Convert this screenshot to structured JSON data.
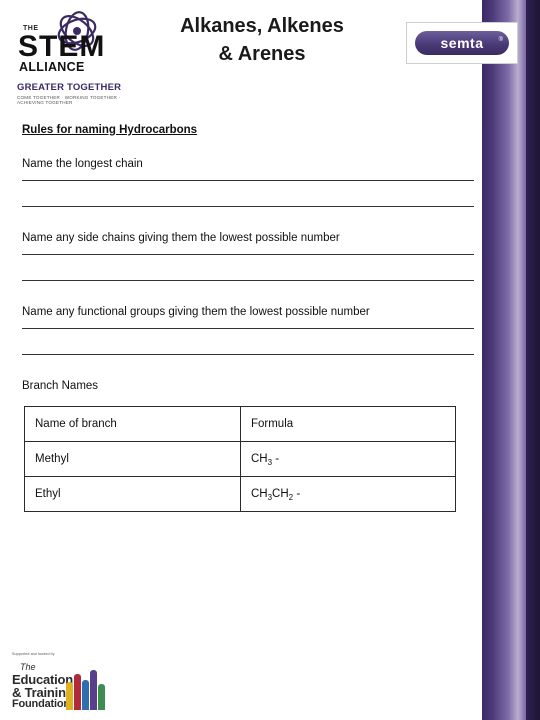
{
  "slide": {
    "title_line1": "Alkanes, Alkenes",
    "title_line2": "& Arenes"
  },
  "logos": {
    "stem": {
      "the": "THE",
      "name": "STEM",
      "sub": "ALLIANCE",
      "strapline": "GREATER TOGETHER",
      "tagline": "COME TOGETHER · WORKING TOGETHER · ACHIEVING TOGETHER"
    },
    "semta": {
      "name": "semta",
      "tm": "®"
    },
    "etf": {
      "micro": "Supported and funded by",
      "the": "The",
      "education": "Education",
      "training": "& Training",
      "foundation": "Foundation"
    }
  },
  "body": {
    "rules_heading": "Rules for naming Hydrocarbons",
    "rules": [
      "Name the longest chain",
      "Name any side chains giving them the lowest possible number",
      "Name any functional groups giving them the lowest possible number"
    ],
    "branch_heading": "Branch Names",
    "table": {
      "headers": [
        "Name of branch",
        "Formula"
      ],
      "rows": [
        {
          "name": "Methyl",
          "formula_prefix": "CH",
          "formula_sub": "3",
          "formula_suffix": " -"
        },
        {
          "name": "Ethyl",
          "formula_prefix": "CH",
          "formula_sub": "3",
          "formula_mid": "CH",
          "formula_sub2": "2",
          "formula_suffix": " -"
        }
      ]
    }
  },
  "colors": {
    "band_purple": "#4c3a7a",
    "band_dark": "#2e2150",
    "text": "#111111",
    "rule_line": "#333333"
  }
}
